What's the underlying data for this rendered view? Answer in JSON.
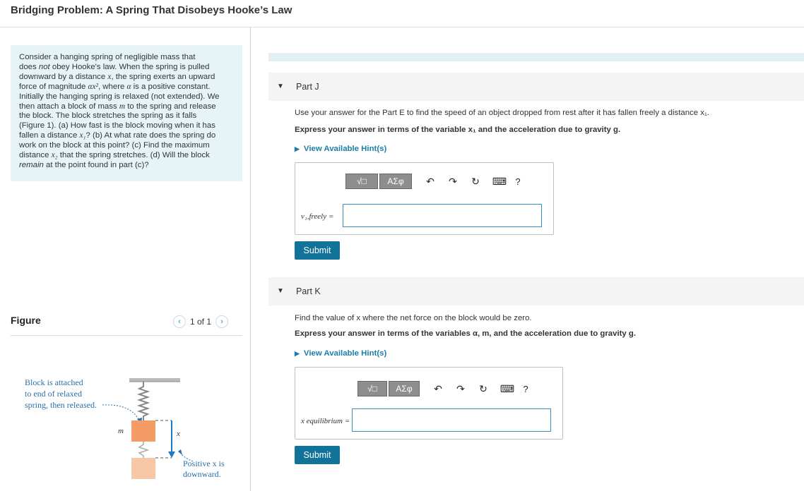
{
  "page_title": "Bridging Problem: A Spring That Disobeys Hooke’s Law",
  "intro_text": [
    {
      "t": "Consider a hanging spring of negligible mass that\ndoes "
    },
    {
      "t": "not",
      "i": true
    },
    {
      "t": " obey Hooke's law. When the spring is pulled\ndownward by a distance "
    },
    {
      "t": "x",
      "m": true
    },
    {
      "t": ", the spring exerts an upward\nforce of magnitude "
    },
    {
      "t": "αx²",
      "m": true
    },
    {
      "t": ", where "
    },
    {
      "t": "α",
      "m": true
    },
    {
      "t": " is a positive constant.\nInitially the hanging spring is relaxed (not extended). We\nthen attach a block of mass "
    },
    {
      "t": "m",
      "m": true
    },
    {
      "t": " to the spring and release\nthe block. The block stretches the spring as it falls\n(Figure 1). (a) How fast is the block moving when it has\nfallen a distance "
    },
    {
      "t": "x₁",
      "m": true
    },
    {
      "t": "? (b) At what rate does the spring do\nwork on the block at this point? (c) Find the maximum\ndistance "
    },
    {
      "t": "x₂",
      "m": true
    },
    {
      "t": " that the spring stretches. (d) Will the block\n"
    },
    {
      "t": "remain",
      "i": true
    },
    {
      "t": " at the point found in part (c)?"
    }
  ],
  "figure": {
    "label": "Figure",
    "pager": "1 of 1",
    "prev_icon": "chevron-left-icon",
    "next_icon": "chevron-right-icon",
    "caption_left_1": "Block is attached",
    "caption_left_2": "to end of relaxed",
    "caption_left_3": "spring, then released.",
    "caption_right_1": "Positive x is",
    "caption_right_2": "downward.",
    "mass_label": "m",
    "axis_label": "x",
    "block_color": "#f39c66",
    "ghost_block_color": "#f8c7a8",
    "arrow_color": "#1f78c8"
  },
  "parts": [
    {
      "title": "Part J",
      "question": "Use your answer for the Part E to find the speed of an object dropped from rest after it has fallen freely a distance x₁.",
      "instruction": "Express your answer in terms of  the variable x₁ and the acceleration due to gravity g.",
      "hint": "View Available Hint(s)",
      "lhs": "v₁,freely =",
      "toolbar": {
        "template": "√□",
        "greek": "ΑΣφ",
        "undo": "↶",
        "redo": "↷",
        "reset": "↻",
        "keyboard": "⌨",
        "help": "?"
      },
      "submit": "Submit"
    },
    {
      "title": "Part K",
      "question": "Find the value of x where the net force on the block would be zero.",
      "instruction": "Express your answer in terms of the variables α, m, and the acceleration due to gravity g.",
      "hint": "View Available Hint(s)",
      "lhs": "x equilibrium =",
      "toolbar": {
        "template": "√□",
        "greek": "ΑΣφ",
        "undo": "↶",
        "redo": "↷",
        "reset": "↻",
        "keyboard": "⌨",
        "help": "?"
      },
      "submit": "Submit"
    }
  ],
  "colors": {
    "accent": "#12739a",
    "link": "#1a7fa8",
    "intro_bg": "#e7f4f7"
  }
}
